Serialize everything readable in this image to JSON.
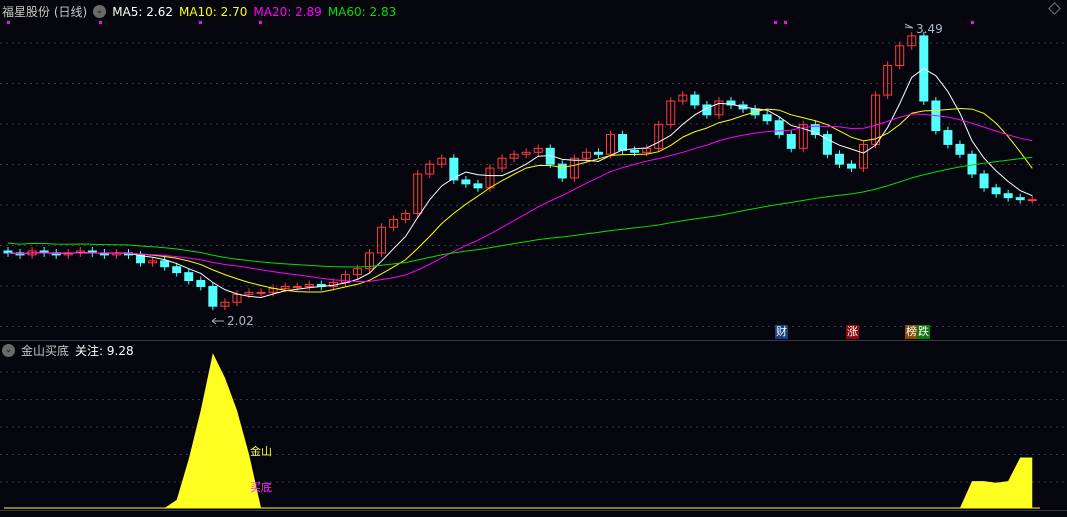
{
  "header": {
    "title": "福星股份 (日线)",
    "ma5": "MA5: 2.62",
    "ma10": "MA10: 2.70",
    "ma20": "MA20: 2.89",
    "ma60": "MA60: 2.83"
  },
  "colors": {
    "up": "#ff3b3b",
    "down": "#54ffff",
    "ma5": "#ffffff",
    "ma10": "#ffff00",
    "ma20": "#ff00ff",
    "ma60": "#00e000",
    "indicator": "#ffff22"
  },
  "price": {
    "high_label": "3.49",
    "low_label": "2.02",
    "high": 3.49,
    "low": 2.02
  },
  "events": [
    {
      "text": "财",
      "bg": "#1a3f7a"
    },
    {
      "text": "涨",
      "bg": "#8a0a0a"
    },
    {
      "text": "榜",
      "bg": "#8a4a00"
    },
    {
      "text": "跌",
      "bg": "#0a7a0a"
    }
  ],
  "indicator": {
    "title": "金山买底",
    "value_label": "关注: 9.28",
    "label_gold": "金山",
    "label_buy": "买底",
    "values": [
      0,
      0,
      0,
      0,
      0,
      0,
      0,
      0,
      0,
      0,
      0,
      0,
      0,
      0,
      0.5,
      3,
      6,
      9.5,
      8,
      6,
      3.3,
      0,
      0,
      0,
      0,
      0,
      0,
      0,
      0,
      0,
      0,
      0,
      0,
      0,
      0,
      0,
      0,
      0,
      0,
      0,
      0,
      0,
      0,
      0,
      0,
      0,
      0,
      0,
      0,
      0,
      0,
      0,
      0,
      0,
      0,
      0,
      0,
      0,
      0,
      0,
      0,
      0,
      0,
      0,
      0,
      0,
      0,
      0,
      0,
      0,
      0,
      0,
      0,
      0,
      0,
      0,
      0,
      0,
      0,
      0,
      1.65,
      1.65,
      1.55,
      1.65,
      3.1,
      3.1
    ]
  },
  "candles": {
    "first_open": 2.36,
    "closes": [
      2.35,
      2.34,
      2.36,
      2.35,
      2.34,
      2.35,
      2.36,
      2.35,
      2.34,
      2.35,
      2.34,
      2.3,
      2.31,
      2.28,
      2.25,
      2.21,
      2.18,
      2.08,
      2.1,
      2.14,
      2.15,
      2.15,
      2.17,
      2.18,
      2.18,
      2.19,
      2.18,
      2.2,
      2.24,
      2.27,
      2.35,
      2.48,
      2.52,
      2.55,
      2.75,
      2.8,
      2.83,
      2.72,
      2.7,
      2.68,
      2.78,
      2.83,
      2.85,
      2.86,
      2.88,
      2.8,
      2.73,
      2.83,
      2.86,
      2.85,
      2.95,
      2.87,
      2.86,
      2.88,
      3.0,
      3.12,
      3.15,
      3.1,
      3.05,
      3.12,
      3.1,
      3.08,
      3.05,
      3.02,
      2.95,
      2.88,
      3.0,
      2.95,
      2.85,
      2.8,
      2.78,
      2.9,
      3.15,
      3.3,
      3.4,
      3.45,
      3.12,
      2.97,
      2.9,
      2.85,
      2.75,
      2.68,
      2.65,
      2.63,
      2.62,
      2.62
    ]
  }
}
